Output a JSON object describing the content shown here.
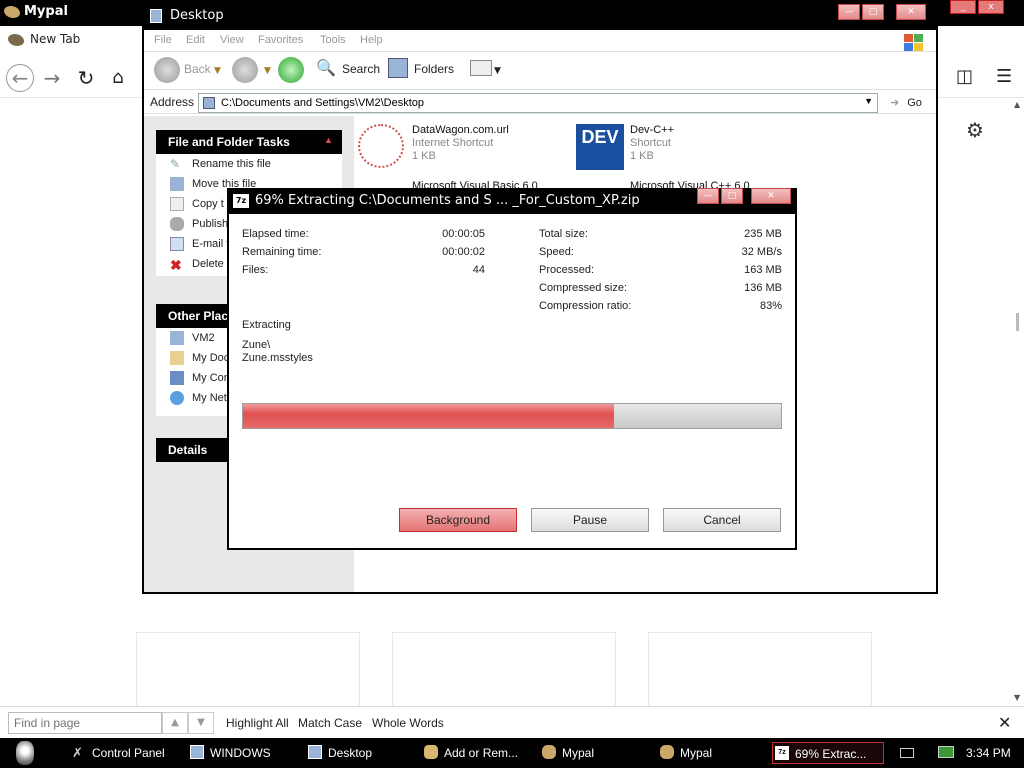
{
  "browser": {
    "title": "Mypal",
    "tab_label": "New Tab",
    "find": {
      "placeholder": "Find in page",
      "highlight_all": "Highlight All",
      "match_case": "Match Case",
      "whole_words": "Whole Words"
    }
  },
  "explorer": {
    "title": "Desktop",
    "menu": [
      "File",
      "Edit",
      "View",
      "Favorites",
      "Tools",
      "Help"
    ],
    "toolbar": {
      "back": "Back",
      "search": "Search",
      "folders": "Folders"
    },
    "address": {
      "label": "Address",
      "value": "C:\\Documents and Settings\\VM2\\Desktop",
      "go": "Go"
    },
    "file_tasks": {
      "title": "File and Folder Tasks",
      "items": [
        "Rename this file",
        "Move this file",
        "Copy t",
        "Publish",
        "E-mail t",
        "Delete"
      ]
    },
    "other_places": {
      "title": "Other Plac",
      "items": [
        "VM2",
        "My Doc",
        "My Cor",
        "My Net"
      ]
    },
    "details": {
      "title": "Details"
    },
    "files": [
      {
        "name": "DataWagon.com.url",
        "type": "Internet Shortcut",
        "size": "1 KB"
      },
      {
        "name": "Dev-C++",
        "type": "Shortcut",
        "size": "1 KB"
      },
      {
        "name": "Microsoft Visual Basic 6.0",
        "type": "",
        "size": ""
      },
      {
        "name": "Microsoft Visual C++ 6.0",
        "type": "",
        "size": ""
      }
    ]
  },
  "extract_dialog": {
    "title": "69% Extracting C:\\Documents and S ... _For_Custom_XP.zip",
    "left_stats": [
      {
        "label": "Elapsed time:",
        "value": "00:00:05"
      },
      {
        "label": "Remaining time:",
        "value": "00:00:02"
      },
      {
        "label": "Files:",
        "value": "44"
      }
    ],
    "right_stats": [
      {
        "label": "Total size:",
        "value": "235 MB"
      },
      {
        "label": "Speed:",
        "value": "32 MB/s"
      },
      {
        "label": "Processed:",
        "value": "163 MB"
      },
      {
        "label": "Compressed size:",
        "value": "136 MB"
      },
      {
        "label": "Compression ratio:",
        "value": "83%"
      }
    ],
    "status_label": "Extracting",
    "current_path": "Zune\\",
    "current_file": "Zune.msstyles",
    "progress": 0.69,
    "buttons": {
      "background": "Background",
      "pause": "Pause",
      "cancel": "Cancel"
    }
  },
  "taskbar": {
    "items": [
      "Control Panel",
      "WINDOWS",
      "Desktop",
      "Add or Rem...",
      "Mypal",
      "Mypal",
      "69% Extrac..."
    ],
    "clock": "3:34 PM"
  },
  "colors": {
    "accent_red": "#e05252",
    "title_black": "#000000"
  }
}
